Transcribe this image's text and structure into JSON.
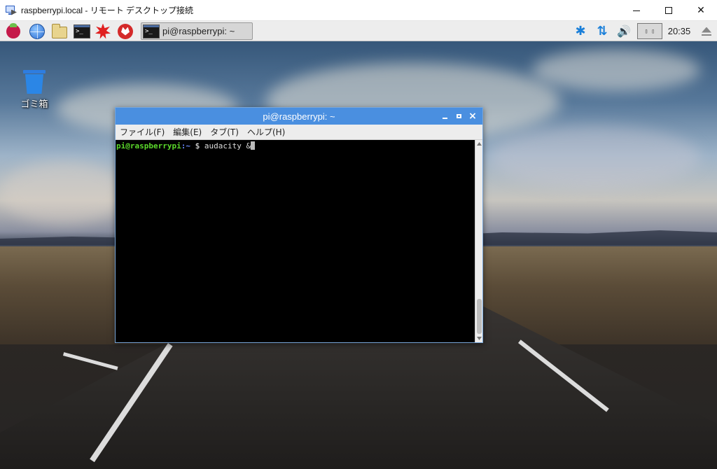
{
  "rdp": {
    "title": "raspberrypi.local - リモート デスクトップ接続",
    "minimize": "—",
    "close": "✕"
  },
  "taskbar": {
    "launchers": [
      "raspberry-menu-icon",
      "web-browser-icon",
      "file-manager-icon",
      "terminal-icon",
      "mathematica-icon",
      "wolfram-icon"
    ],
    "task_window_label": "pi@raspberrypi: ~",
    "tray": {
      "bluetooth": "✱",
      "network": "⇅",
      "volume": "🔊",
      "cpu": "▯ ▯",
      "clock": "20:35"
    }
  },
  "desktop": {
    "trash_label": "ゴミ箱"
  },
  "terminal": {
    "title": "pi@raspberrypi: ~",
    "menu": [
      "ファイル(F)",
      "編集(E)",
      "タブ(T)",
      "ヘルプ(H)"
    ],
    "prompt_user": "pi@raspberrypi",
    "prompt_path": ":~ ",
    "prompt_symbol": "$ ",
    "command": "audacity &",
    "close": "×"
  },
  "colors": {
    "terminal_title_bar": "#4a8fe0",
    "prompt_user": "#5bd92b",
    "tray_icons": "#1a7fd9"
  }
}
